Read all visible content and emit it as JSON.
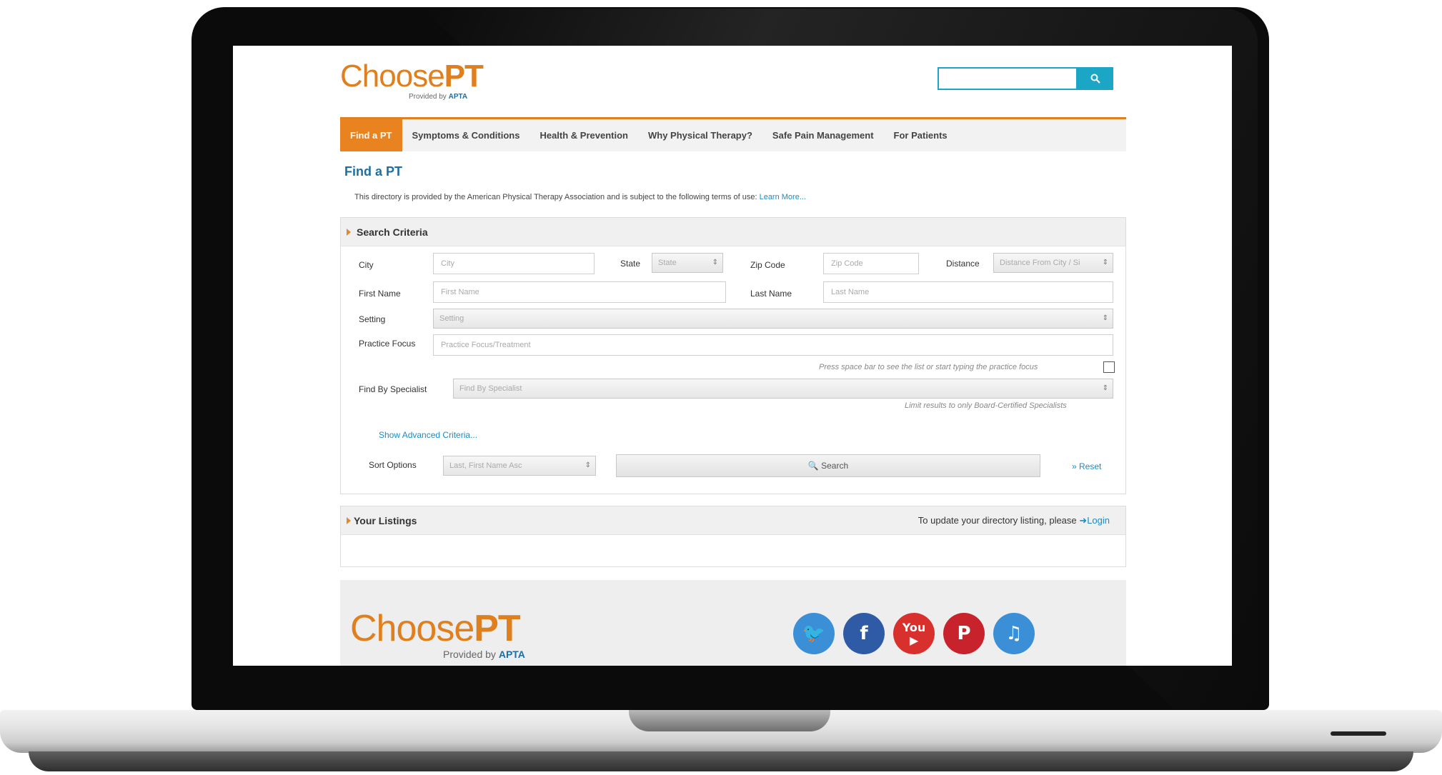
{
  "header": {
    "logo_text_light": "Choose",
    "logo_text_bold": "PT",
    "logo_sub_prefix": "Provided by",
    "logo_sub_brand": "APTA",
    "search_placeholder": "",
    "search_icon": "search-icon"
  },
  "nav": {
    "items": [
      {
        "label": "Find a PT",
        "active": true
      },
      {
        "label": "Symptoms & Conditions"
      },
      {
        "label": "Health & Prevention"
      },
      {
        "label": "Why Physical Therapy?"
      },
      {
        "label": "Safe Pain Management"
      },
      {
        "label": "For Patients"
      }
    ]
  },
  "main": {
    "title": "Find a PT",
    "terms_text": "This directory is provided by the American Physical Therapy Association and is subject to the following terms of use:",
    "terms_link": "Learn More..."
  },
  "criteria": {
    "heading": "Search Criteria",
    "city_label": "City",
    "city_placeholder": "City",
    "state_label": "State",
    "state_value": "State",
    "zip_label": "Zip Code",
    "zip_placeholder": "Zip Code",
    "distance_label": "Distance",
    "distance_value": "Distance From City / Si",
    "first_name_label": "First Name",
    "first_name_placeholder": "First Name",
    "last_name_label": "Last Name",
    "last_name_placeholder": "Last Name",
    "setting_label": "Setting",
    "setting_value": "Setting",
    "practice_label": "Practice Focus",
    "practice_placeholder": "Practice Focus/Treatment",
    "practice_hint": "Press space bar to see the list or start typing the practice focus",
    "specialist_label": "Find By Specialist",
    "specialist_value": "Find By Specialist",
    "specialist_hint": "Limit results to only Board-Certified Specialists",
    "advanced_link": "Show Advanced Criteria...",
    "sort_label": "Sort Options",
    "sort_value": "Last, First Name Asc",
    "search_button": "Search",
    "reset_link": "Reset"
  },
  "listings": {
    "heading": "Your Listings",
    "note": "To update your directory listing, please",
    "login_link": "Login"
  },
  "footer": {
    "logo_text_light": "Choose",
    "logo_text_bold": "PT",
    "logo_sub_prefix": "Provided by",
    "logo_sub_brand": "APTA",
    "social": [
      {
        "name": "twitter-icon",
        "color": "#3b8fd6"
      },
      {
        "name": "facebook-icon",
        "color": "#2f5ba6"
      },
      {
        "name": "youtube-icon",
        "color": "#d8302c"
      },
      {
        "name": "pinterest-icon",
        "color": "#c8232c"
      },
      {
        "name": "music-icon",
        "color": "#3a8fd6"
      }
    ]
  },
  "colors": {
    "brand_orange": "#e07f1d",
    "link_blue": "#1c8bc4",
    "search_teal": "#1aa6c4"
  }
}
